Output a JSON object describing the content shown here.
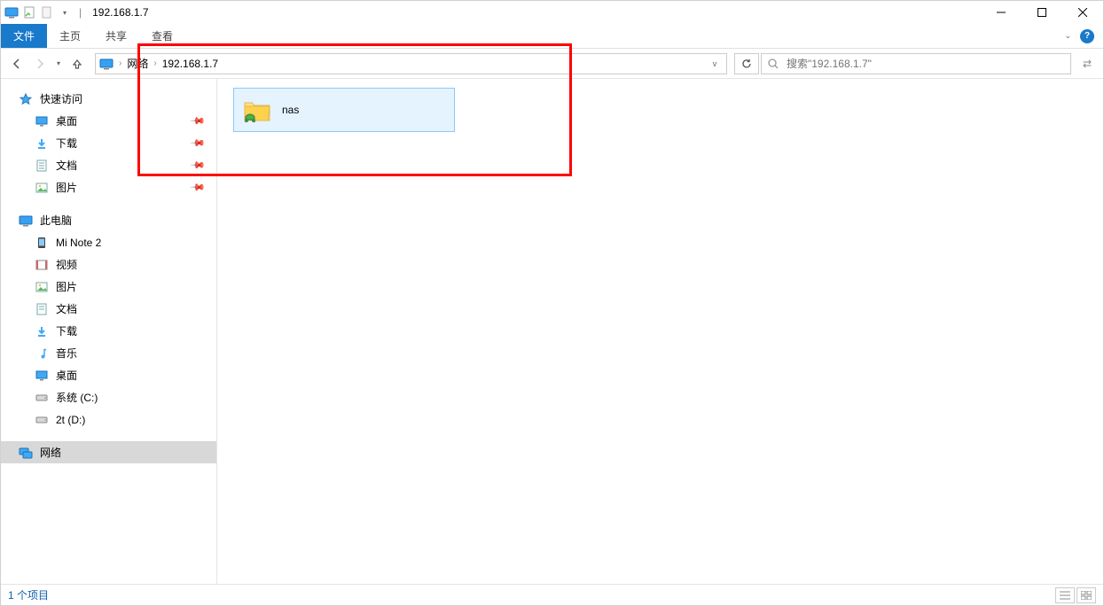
{
  "window": {
    "title": "192.168.1.7"
  },
  "ribbon": {
    "file": "文件",
    "tabs": [
      "主页",
      "共享",
      "查看"
    ]
  },
  "breadcrumb": {
    "root": "网络",
    "current": "192.168.1.7"
  },
  "search": {
    "placeholder": "搜索\"192.168.1.7\""
  },
  "sidebar": {
    "quick_access": "快速访问",
    "quick_items": [
      {
        "label": "桌面",
        "icon": "desktop"
      },
      {
        "label": "下载",
        "icon": "download"
      },
      {
        "label": "文档",
        "icon": "document"
      },
      {
        "label": "图片",
        "icon": "pictures"
      }
    ],
    "this_pc": "此电脑",
    "pc_items": [
      {
        "label": "Mi Note 2",
        "icon": "phone"
      },
      {
        "label": "视频",
        "icon": "video"
      },
      {
        "label": "图片",
        "icon": "pictures"
      },
      {
        "label": "文档",
        "icon": "document"
      },
      {
        "label": "下载",
        "icon": "download"
      },
      {
        "label": "音乐",
        "icon": "music"
      },
      {
        "label": "桌面",
        "icon": "desktop"
      },
      {
        "label": "系统 (C:)",
        "icon": "drive"
      },
      {
        "label": "2t (D:)",
        "icon": "drive"
      }
    ],
    "network": "网络"
  },
  "content": {
    "items": [
      {
        "label": "nas"
      }
    ]
  },
  "status": {
    "count_text": "1 个项目"
  }
}
